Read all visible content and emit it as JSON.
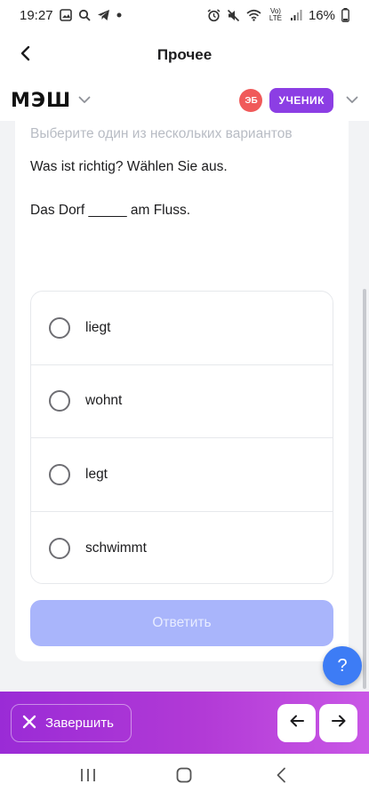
{
  "status_bar": {
    "time": "19:27",
    "battery": "16%",
    "network_label": "Vo) LTE"
  },
  "app_bar": {
    "title": "Прочее",
    "back_icon": "chevron-left-icon"
  },
  "brand_bar": {
    "logo": "МЭШ",
    "avatar_initials": "ЭБ",
    "role": "УЧЕНИК",
    "colors": {
      "avatar": "#f05a5a",
      "role_badge": "#8c3ee4"
    }
  },
  "task": {
    "hint": "Выберите один из нескольких вариантов",
    "question": "Was ist richtig? Wählen Sie aus.",
    "sentence": "Das Dorf _____ am Fluss.",
    "options": [
      {
        "label": "liegt",
        "selected": false
      },
      {
        "label": "wohnt",
        "selected": false
      },
      {
        "label": "legt",
        "selected": false
      },
      {
        "label": "schwimmt",
        "selected": false
      }
    ],
    "submit_label": "Ответить",
    "submit_enabled": false
  },
  "help": {
    "label": "?"
  },
  "action_bar": {
    "finish_label": "Завершить",
    "prev_icon": "arrow-left-icon",
    "next_icon": "arrow-right-icon",
    "colors": {
      "gradient_start": "#9a2bd6",
      "gradient_end": "#c957e6"
    }
  },
  "accent_color": "#a9b5fb"
}
